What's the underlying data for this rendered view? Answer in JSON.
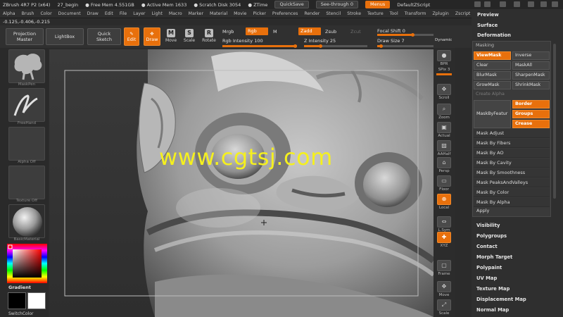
{
  "titlebar": {
    "app": "ZBrush 4R7 P2 (x64)",
    "doc": "27_begin",
    "free_mem": "● Free Mem 4.551GB",
    "active_mem": "● Active Mem 1633",
    "scratch": "● Scratch Disk 3054",
    "ztime": "● ZTime",
    "quicksave": "QuickSave",
    "seethrough": "See-through  0",
    "menus": "Menus",
    "script": "DefaultZScript"
  },
  "menubar": [
    "Alpha",
    "Brush",
    "Color",
    "Document",
    "Draw",
    "Edit",
    "File",
    "Layer",
    "Light",
    "Macro",
    "Marker",
    "Material",
    "Movie",
    "Picker",
    "Preferences",
    "Render",
    "Stencil",
    "Stroke",
    "Texture",
    "Tool",
    "Transform",
    "Zplugin",
    "Zscript"
  ],
  "coords": "-0.125,-0.406,-0.215",
  "toolbar": {
    "projection_master": [
      "Projection",
      "Master"
    ],
    "lightbox": "LightBox",
    "quick_sketch": [
      "Quick",
      "Sketch"
    ],
    "edit": "Edit",
    "draw": "Draw",
    "move": "Move",
    "scale": "Scale",
    "rotate": "Rotate",
    "mrgb": "Mrgb",
    "rgb": "Rgb",
    "m": "M",
    "zadd": "Zadd",
    "zsub": "Zsub",
    "zcut": "Zcut",
    "rgb_intensity": "Rgb Intensity 100",
    "z_intensity": "Z Intensity 25",
    "focal_shift": "Focal Shift 0",
    "draw_size": "Draw Size 7",
    "dynamic": "Dynamic"
  },
  "toolbar_levels": {
    "rgb_intensity_fraction": 1.0,
    "z_intensity_fraction": 0.25,
    "focal_shift_fraction": 0.5,
    "draw_size_fraction": 0.06
  },
  "lefttray": {
    "brush": "MaskPen",
    "stroke": "FreeHand",
    "alpha": "Alpha  Off",
    "texture": "Texture  Off",
    "material": "BasicMaterial",
    "gradient": "Gradient",
    "switchcolor": "SwitchColor"
  },
  "viewport": {
    "watermark": "www.cgtsj.com"
  },
  "rshelf": [
    {
      "label": "BPR",
      "icon": "sphere-icon"
    },
    {
      "label": "SPix 3",
      "icon": "spix-slider"
    },
    {
      "label": "Scroll",
      "icon": "scroll-icon"
    },
    {
      "label": "Zoom",
      "icon": "zoom-icon"
    },
    {
      "label": "Actual",
      "icon": "actual-icon"
    },
    {
      "label": "AAHalf",
      "icon": "aahalf-icon"
    },
    {
      "label": "Persp",
      "icon": "persp-icon"
    },
    {
      "label": "Floor",
      "icon": "floor-icon"
    },
    {
      "label": "Local",
      "icon": "local-icon"
    },
    {
      "label": "L.Sym",
      "icon": "lsym-icon"
    },
    {
      "label": "XYZ",
      "icon": "xyz-icon"
    },
    {
      "label": "Frame",
      "icon": "frame-icon"
    },
    {
      "label": "Move",
      "icon": "move-icon"
    },
    {
      "label": "Scale",
      "icon": "scale-icon"
    }
  ],
  "rpanel": {
    "top": [
      "Preview",
      "Surface",
      "Deformation"
    ],
    "masking_title": "Masking",
    "buttons": {
      "viewmask": "ViewMask",
      "inverse": "Inverse",
      "clear": "Clear",
      "maskall": "MaskAll",
      "blurmask": "BlurMask",
      "sharpenmask": "SharpenMask",
      "growmask": "GrowMask",
      "shrinkmask": "ShrinkMask",
      "create_alpha": "Create Alpha",
      "mask_by_feature": "MaskByFeatur",
      "border": "Border",
      "groups": "Groups",
      "crease": "Crease"
    },
    "rows": [
      "Mask Adjust",
      "Mask By Fibers",
      "Mask By AO",
      "Mask By Cavity",
      "Mask By Smoothness",
      "Mask PeaksAndValleys",
      "Mask By Color",
      "Mask By Alpha"
    ],
    "apply": "Apply",
    "bottom": [
      "Visibility",
      "Polygroups",
      "Contact",
      "Morph Target",
      "Polypaint",
      "UV Map",
      "Texture Map",
      "Displacement Map",
      "Normal Map"
    ]
  },
  "colors": {
    "accent": "#e8700c",
    "watermark": "#f5f01e"
  }
}
